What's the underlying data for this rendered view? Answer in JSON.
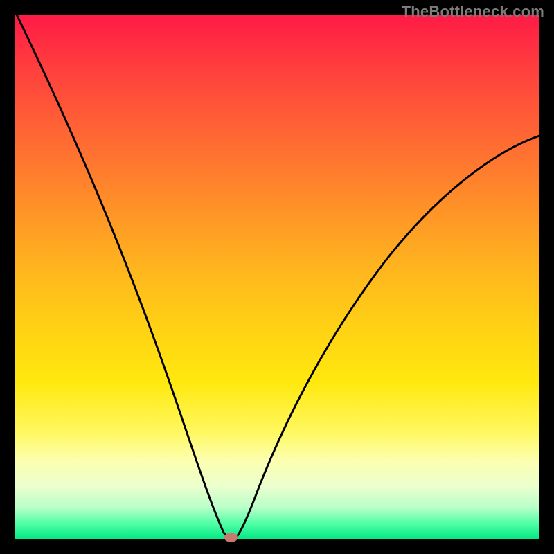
{
  "watermark": "TheBottleneck.com",
  "chart_data": {
    "type": "line",
    "title": "",
    "xlabel": "",
    "ylabel": "",
    "xlim": [
      0,
      100
    ],
    "ylim": [
      0,
      100
    ],
    "x": [
      0,
      5,
      10,
      15,
      20,
      25,
      30,
      35,
      38,
      40,
      41,
      42,
      45,
      50,
      55,
      60,
      65,
      70,
      75,
      80,
      85,
      90,
      95,
      100
    ],
    "values": [
      100,
      93,
      85,
      77,
      68,
      58,
      46,
      29,
      10,
      1,
      0,
      1,
      10,
      24,
      34,
      42,
      49,
      55,
      60,
      64,
      68,
      71,
      74,
      76
    ],
    "series": [
      {
        "name": "bottleneck-curve",
        "color": "#000000"
      }
    ],
    "marker": {
      "x_frac": 0.41,
      "color": "#c97a6e"
    }
  }
}
